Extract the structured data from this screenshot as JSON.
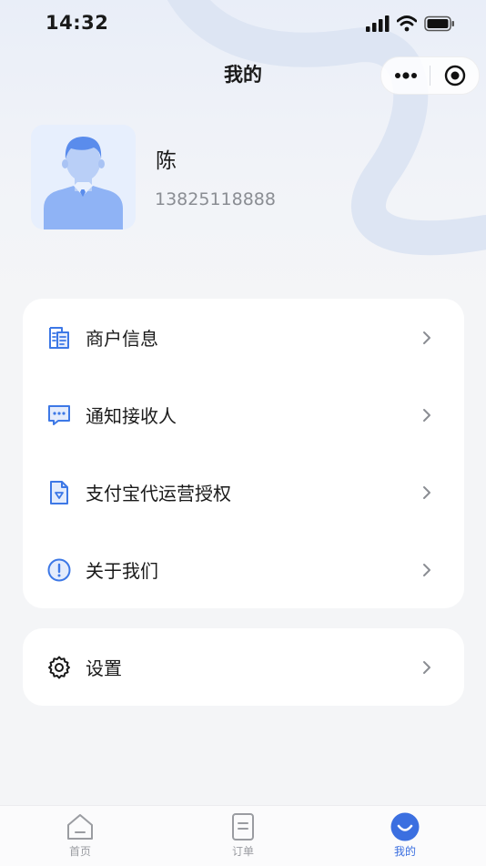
{
  "status_bar": {
    "time": "14:32"
  },
  "nav": {
    "title": "我的"
  },
  "profile": {
    "name": "陈",
    "phone": "13825118888"
  },
  "menu": [
    {
      "label": "商户信息",
      "icon": "merchant-info-icon"
    },
    {
      "label": "通知接收人",
      "icon": "message-icon"
    },
    {
      "label": "支付宝代运营授权",
      "icon": "authorization-doc-icon"
    },
    {
      "label": "关于我们",
      "icon": "info-circle-icon"
    }
  ],
  "settings": {
    "label": "设置",
    "icon": "gear-icon"
  },
  "tabbar": {
    "items": [
      {
        "label": "首页",
        "icon": "home-icon",
        "active": false
      },
      {
        "label": "订单",
        "icon": "order-icon",
        "active": false
      },
      {
        "label": "我的",
        "icon": "profile-icon",
        "active": true
      }
    ]
  },
  "colors": {
    "accent": "#3b6fe0",
    "icon_blue": "#3d78e6",
    "page_bg": "#f4f5f7"
  }
}
